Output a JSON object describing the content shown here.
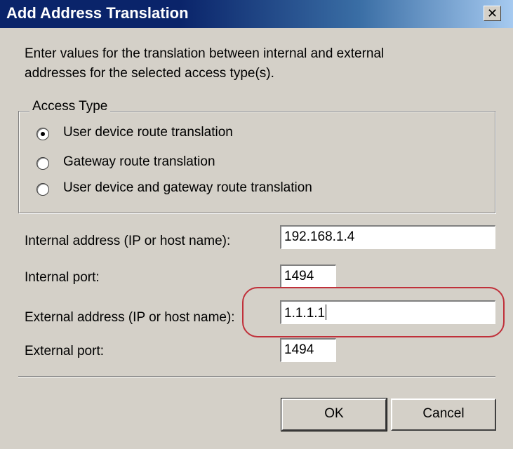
{
  "dialog": {
    "title": "Add Address Translation",
    "close_label": "✕",
    "description_line1": "Enter values for the translation between internal and external",
    "description_line2": "addresses for the selected access type(s)."
  },
  "access_type": {
    "legend": "Access Type",
    "options": [
      {
        "label": "User device route translation",
        "selected": true
      },
      {
        "label": "Gateway route translation",
        "selected": false
      },
      {
        "label": "User device and gateway route translation",
        "selected": false
      }
    ]
  },
  "fields": {
    "internal_address_label": "Internal address (IP or host name):",
    "internal_address_value": "192.168.1.4",
    "internal_port_label": "Internal port:",
    "internal_port_value": "1494",
    "external_address_label": "External address (IP or host name):",
    "external_address_value": "1.1.1.1",
    "external_port_label": "External port:",
    "external_port_value": "1494"
  },
  "buttons": {
    "ok_label": "OK",
    "cancel_label": "Cancel"
  },
  "colors": {
    "titlebar": "#0a246a",
    "dialog_bg": "#d4d0c8",
    "highlight": "#c0303a"
  },
  "icons": {
    "close": "close-icon",
    "radio": "radio-button"
  }
}
